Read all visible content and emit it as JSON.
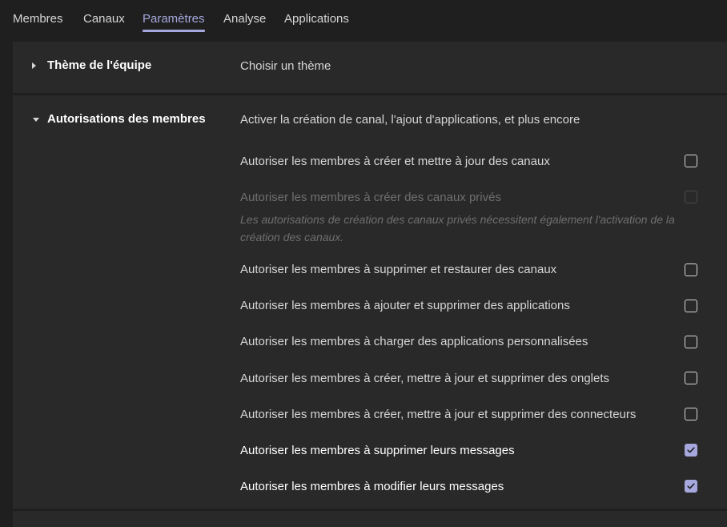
{
  "tabs": [
    {
      "label": "Membres"
    },
    {
      "label": "Canaux"
    },
    {
      "label": "Paramètres"
    },
    {
      "label": "Analyse"
    },
    {
      "label": "Applications"
    }
  ],
  "active_tab": "Paramètres",
  "theme_section": {
    "title": "Thème de l'équipe",
    "description": "Choisir un thème",
    "expanded": false
  },
  "permissions_section": {
    "title": "Autorisations des membres",
    "description": "Activer la création de canal, l'ajout d'applications, et plus encore",
    "expanded": true,
    "options": [
      {
        "label": "Autoriser les membres à créer et mettre à jour des canaux",
        "checked": false,
        "disabled": false
      },
      {
        "label": "Autoriser les membres à créer des canaux privés",
        "checked": false,
        "disabled": true
      },
      {
        "label": "Autoriser les membres à supprimer et restaurer des canaux",
        "checked": false,
        "disabled": false
      },
      {
        "label": "Autoriser les membres à ajouter et supprimer des applications",
        "checked": false,
        "disabled": false
      },
      {
        "label": "Autoriser les membres à charger des applications personnalisées",
        "checked": false,
        "disabled": false
      },
      {
        "label": "Autoriser les membres à créer, mettre à jour et supprimer des onglets",
        "checked": false,
        "disabled": false
      },
      {
        "label": "Autoriser les membres à créer, mettre à jour et supprimer des connecteurs",
        "checked": false,
        "disabled": false
      },
      {
        "label": "Autoriser les membres à supprimer leurs messages",
        "checked": true,
        "disabled": false
      },
      {
        "label": "Autoriser les membres à modifier leurs messages",
        "checked": true,
        "disabled": false
      }
    ],
    "private_channels_note": "Les autorisations de création des canaux privés nécessitent également l'activation de la création des canaux."
  },
  "colors": {
    "accent": "#a6a7dc",
    "background": "#1f1f1f",
    "panel": "#292929"
  }
}
